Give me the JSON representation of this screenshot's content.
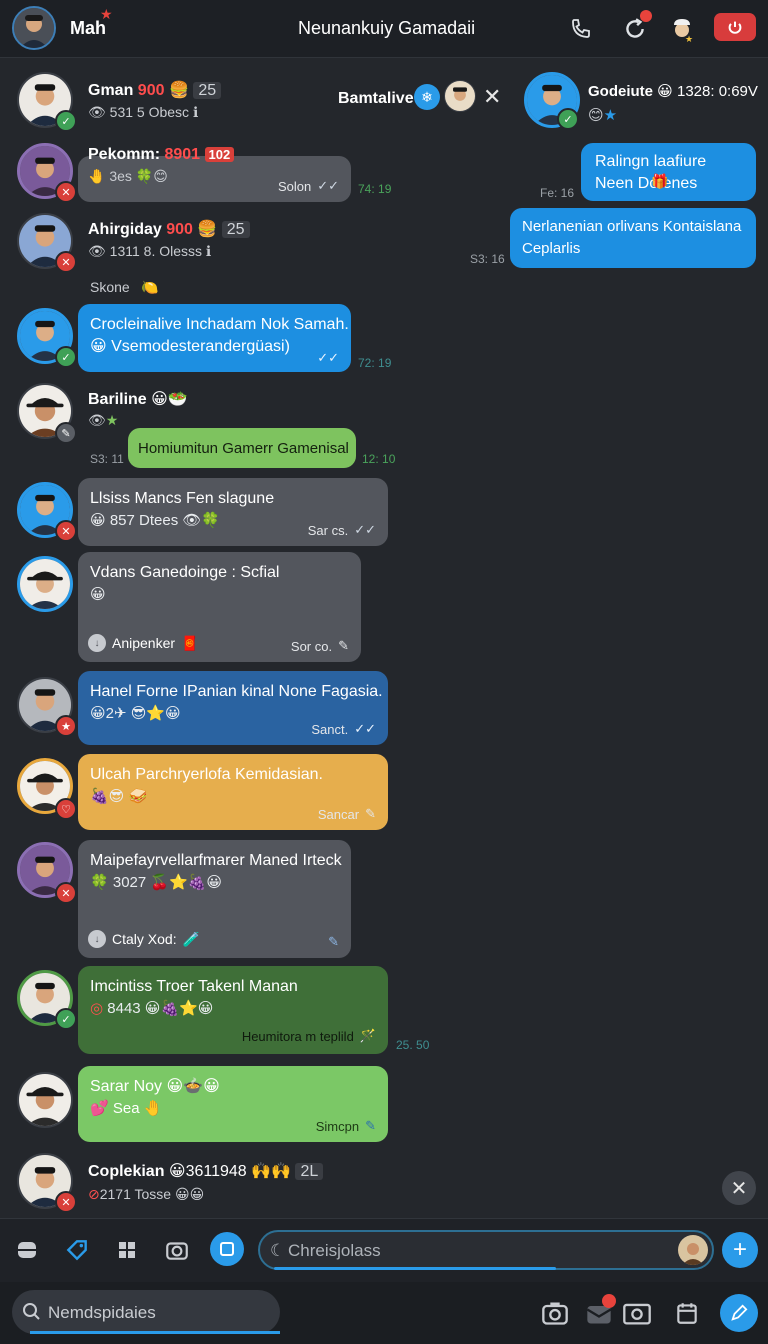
{
  "header": {
    "user_name": "Mah",
    "title": "Neunankuiy Gamadaii"
  },
  "contacts": [
    {
      "name": "Gman",
      "num": "900",
      "count": "25",
      "sub": "531 5 Obesc"
    },
    {
      "name": "Pekomm:",
      "num": "8901",
      "tag": "102",
      "sub": "3es"
    },
    {
      "name": "Ahirgiday",
      "num": "900",
      "count": "25",
      "sub": "1311 8. Olesss"
    },
    {
      "name": "Bariline"
    },
    {
      "name": "Coplekian",
      "num": "3611948",
      "count": "2L",
      "sub": "2171 Tosse"
    }
  ],
  "top_center": {
    "label": "Bamtalive"
  },
  "top_right": {
    "name": "Godeiute",
    "info": "1328: 0:69V"
  },
  "note": {
    "text": "Skone"
  },
  "messages": {
    "pekomm_footer": "Solon",
    "pekomm_time": "74: 19",
    "right1_text": "Ralingn laafiure Neen Dofenes",
    "right1_time": "Fe: 16",
    "right2_text": "Nerlanenian orlivans Kontaislana Ceplarlis",
    "right2_time": "S3: 16",
    "blue1_line1": "Crocleinalive Inchadam Nok Samah.",
    "blue1_line2": "Vsemodesterandergüasi)",
    "blue1_time": "72: 19",
    "green1_text": "Homiumitun Gamerr Gamenisal",
    "green1_time_left": "S3: 11",
    "green1_time_right": "12: 10",
    "grey1_text": "Llsiss Mancs Fen slagune",
    "grey1_sub": "857 Dtees",
    "grey1_footer": "Sar cs.",
    "grey2_text": "Vdans Ganedoinge : Scfial",
    "grey2_left": "Anipenker",
    "grey2_footer": "Sor co.",
    "navy1_text": "Hanel Forne IPanian kinal None Fagasia.",
    "navy1_sub": "2",
    "navy1_footer": "Sanct.",
    "orange1_text": "Ulcah Parchryerlofa Kemidasian.",
    "orange1_footer": "Sancar",
    "grey3_text": "Maipefayrvellarfmarer Maned Irteck",
    "grey3_sub": "3027",
    "grey3_left": "Ctaly Xod:",
    "dg1_text": "Imcintiss Troer Takenl Manan",
    "dg1_sub": "8443",
    "dg1_footer": "Heumitora m teplild",
    "dg1_time": "25. 50",
    "lg1_text": "Sarar Noy",
    "lg1_sub": "Sea",
    "lg1_footer": "Simcpn"
  },
  "composer": {
    "placeholder": "Chreisjolass"
  },
  "search": {
    "placeholder": "Nemdspidaies"
  },
  "colors": {
    "accent": "#2a9be9",
    "danger": "#d83c3c",
    "green": "#7ec35f",
    "orange": "#e6ae4d"
  }
}
